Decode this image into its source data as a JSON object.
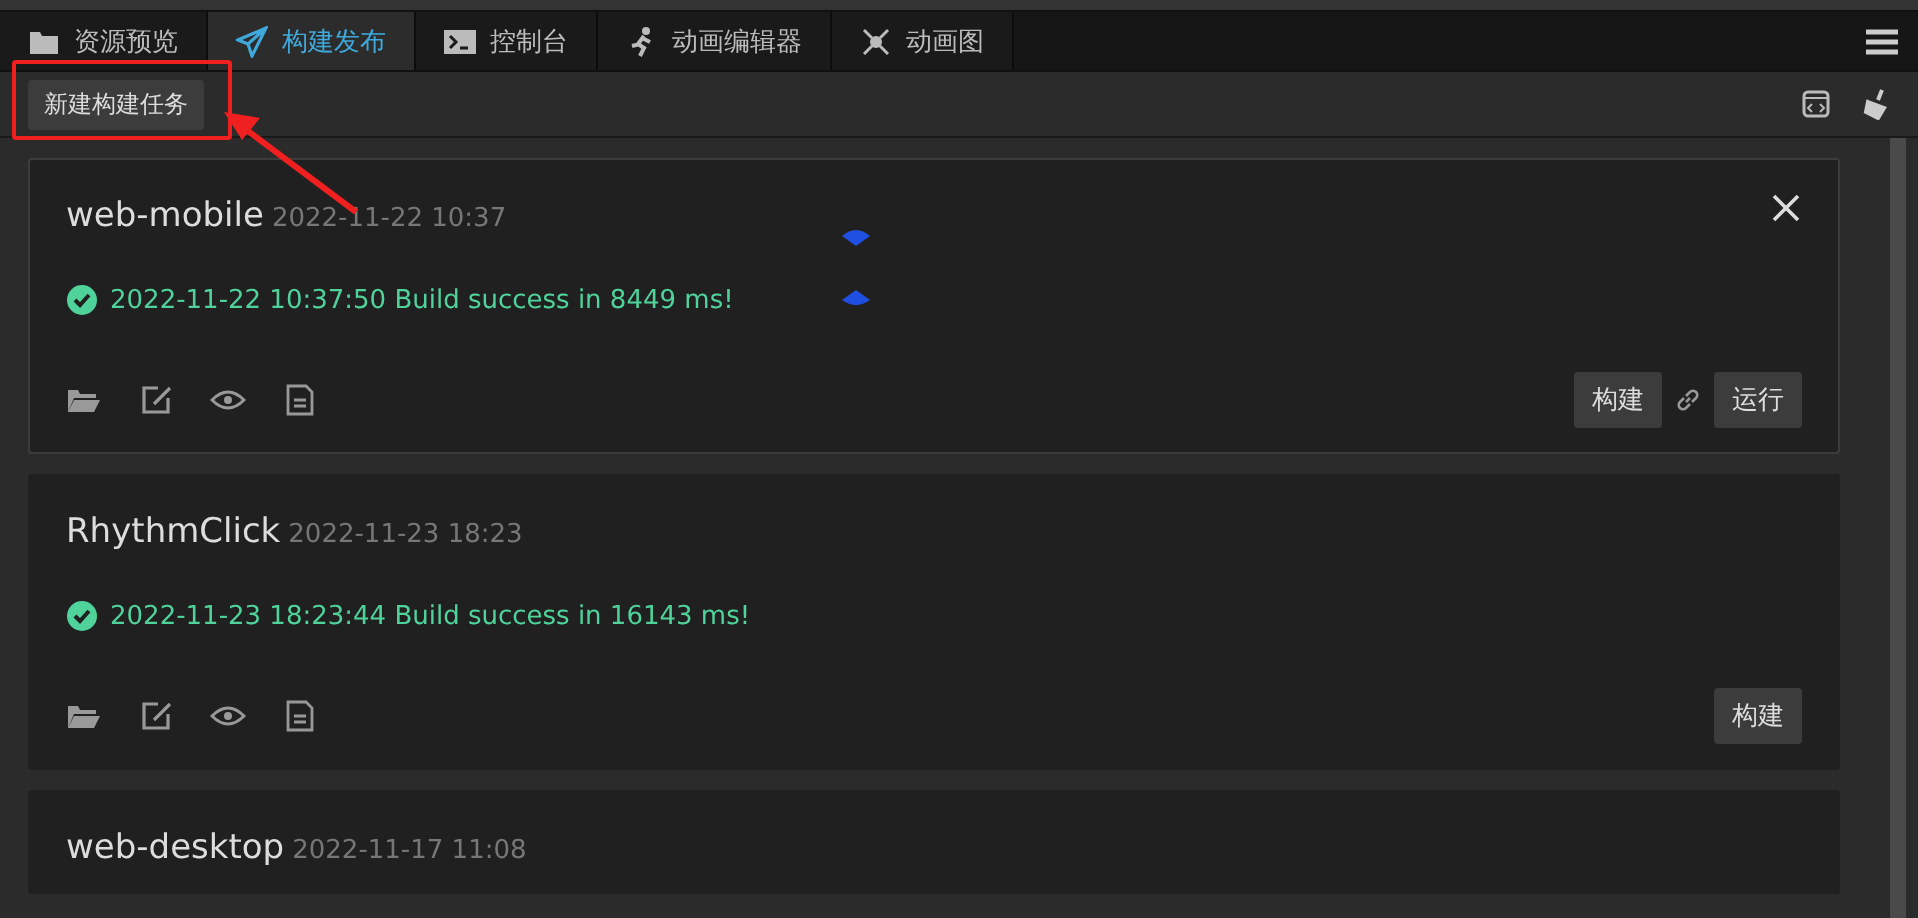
{
  "tabs": [
    {
      "label": "资源预览",
      "selected": false
    },
    {
      "label": "构建发布",
      "selected": true
    },
    {
      "label": "控制台",
      "selected": false
    },
    {
      "label": "动画编辑器",
      "selected": false
    },
    {
      "label": "动画图",
      "selected": false
    }
  ],
  "toolbar": {
    "new_task_button": "新建构建任务"
  },
  "tasks": [
    {
      "name": "web-mobile",
      "time": "2022-11-22 10:37",
      "log": "2022-11-22 10:37:50 Build success in 8449 ms!",
      "selected": true,
      "buttons": [
        "构建",
        "运行"
      ]
    },
    {
      "name": "RhythmClick",
      "time": "2022-11-23 18:23",
      "log": "2022-11-23 18:23:44 Build success in 16143 ms!",
      "selected": false,
      "buttons": [
        "构建"
      ]
    },
    {
      "name": "web-desktop",
      "time": "2022-11-17 11:08",
      "selected": false
    }
  ]
}
